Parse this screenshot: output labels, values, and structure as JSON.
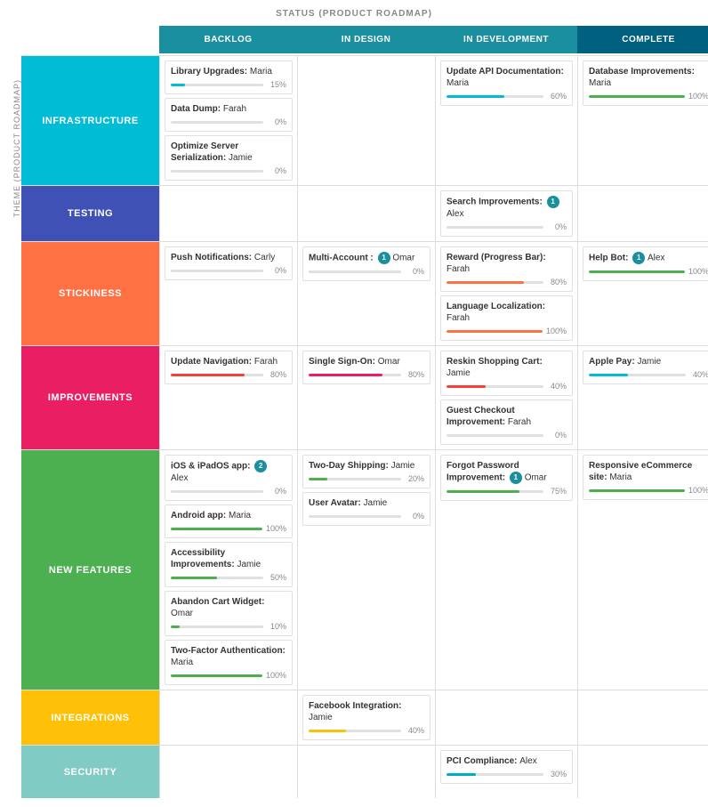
{
  "title": "STATUS (PRODUCT ROADMAP)",
  "vertical_label": "THEME (PRODUCT ROADMAP)",
  "columns": [
    "",
    "BACKLOG",
    "IN DESIGN",
    "IN DEVELOPMENT",
    "COMPLETE"
  ],
  "rows": [
    {
      "label": "INFRASTRUCTURE",
      "label_class": "infrastructure",
      "backlog": [
        {
          "title": "Library Upgrades:",
          "assignee": "Maria",
          "progress": 15,
          "color": "color-teal",
          "badge": null
        },
        {
          "title": "Data Dump:",
          "assignee": "Farah",
          "progress": 0,
          "color": "color-teal",
          "badge": null
        },
        {
          "title": "Optimize Server Serialization:",
          "assignee": "Jamie",
          "progress": 0,
          "color": "color-teal",
          "badge": null
        }
      ],
      "in_design": [],
      "in_dev": [
        {
          "title": "Update API Documentation:",
          "assignee": "Maria",
          "progress": 60,
          "color": "color-teal",
          "badge": null
        }
      ],
      "complete": [
        {
          "title": "Database Improvements:",
          "assignee": "Maria",
          "progress": 100,
          "color": "color-green",
          "badge": null
        }
      ]
    },
    {
      "label": "TESTING",
      "label_class": "testing",
      "backlog": [],
      "in_design": [],
      "in_dev": [
        {
          "title": "Search Improvements:",
          "assignee": "Alex",
          "progress": 0,
          "color": "color-gray",
          "badge": 1
        }
      ],
      "complete": []
    },
    {
      "label": "STICKINESS",
      "label_class": "stickiness",
      "backlog": [
        {
          "title": "Push Notifications:",
          "assignee": "Carly",
          "progress": 0,
          "color": "color-orange",
          "badge": null
        }
      ],
      "in_design": [
        {
          "title": "Multi-Account :",
          "assignee": "Omar",
          "progress": 0,
          "color": "color-pink",
          "badge": 1
        }
      ],
      "in_dev": [
        {
          "title": "Reward (Progress Bar):",
          "assignee": "Farah",
          "progress": 80,
          "color": "color-orange",
          "badge": null
        },
        {
          "title": "Language Localization:",
          "assignee": "Farah",
          "progress": 100,
          "color": "color-orange",
          "badge": null
        }
      ],
      "complete": [
        {
          "title": "Help Bot:",
          "assignee": "Alex",
          "progress": 100,
          "color": "color-green",
          "badge": 1
        }
      ]
    },
    {
      "label": "IMPROVEMENTS",
      "label_class": "improvements",
      "backlog": [
        {
          "title": "Update Navigation:",
          "assignee": "Farah",
          "progress": 80,
          "color": "color-red",
          "badge": null
        }
      ],
      "in_design": [
        {
          "title": "Single Sign-On:",
          "assignee": "Omar",
          "progress": 80,
          "color": "color-pink",
          "badge": null
        }
      ],
      "in_dev": [
        {
          "title": "Reskin Shopping Cart:",
          "assignee": "Jamie",
          "progress": 40,
          "color": "color-red",
          "badge": null
        },
        {
          "title": "Guest Checkout Improvement:",
          "assignee": "Farah",
          "progress": 0,
          "color": "color-red",
          "badge": null
        }
      ],
      "complete": [
        {
          "title": "Apple Pay:",
          "assignee": "Jamie",
          "progress": 40,
          "color": "color-teal",
          "badge": null
        }
      ]
    },
    {
      "label": "NEW FEATURES",
      "label_class": "new-features",
      "backlog": [
        {
          "title": "iOS & iPadOS app:",
          "assignee": "Alex",
          "progress": 0,
          "color": "color-green",
          "badge": 2
        },
        {
          "title": "Android app:",
          "assignee": "Maria",
          "progress": 100,
          "color": "color-green",
          "badge": null
        },
        {
          "title": "Accessibility Improvements:",
          "assignee": "Jamie",
          "progress": 50,
          "color": "color-green",
          "badge": null
        },
        {
          "title": "Abandon Cart Widget:",
          "assignee": "Omar",
          "progress": 10,
          "color": "color-green",
          "badge": null
        },
        {
          "title": "Two-Factor Authentication:",
          "assignee": "Maria",
          "progress": 100,
          "color": "color-green",
          "badge": null
        }
      ],
      "in_design": [
        {
          "title": "Two-Day Shipping:",
          "assignee": "Jamie",
          "progress": 20,
          "color": "color-green",
          "badge": null
        },
        {
          "title": "User Avatar:",
          "assignee": "Jamie",
          "progress": 0,
          "color": "color-green",
          "badge": null
        }
      ],
      "in_dev": [
        {
          "title": "Forgot Password Improvement:",
          "assignee": "Omar",
          "progress": 75,
          "color": "color-green",
          "badge": 1
        }
      ],
      "complete": [
        {
          "title": "Responsive eCommerce site:",
          "assignee": "Maria",
          "progress": 100,
          "color": "color-green",
          "badge": null
        }
      ]
    },
    {
      "label": "INTEGRATIONS",
      "label_class": "integrations",
      "backlog": [],
      "in_design": [
        {
          "title": "Facebook Integration:",
          "assignee": "Jamie",
          "progress": 40,
          "color": "color-yellow",
          "badge": null
        }
      ],
      "in_dev": [],
      "complete": []
    },
    {
      "label": "SECURITY",
      "label_class": "security",
      "backlog": [],
      "in_design": [],
      "in_dev": [
        {
          "title": "PCI Compliance:",
          "assignee": "Alex",
          "progress": 30,
          "color": "color-cyan",
          "badge": null
        }
      ],
      "complete": []
    }
  ]
}
